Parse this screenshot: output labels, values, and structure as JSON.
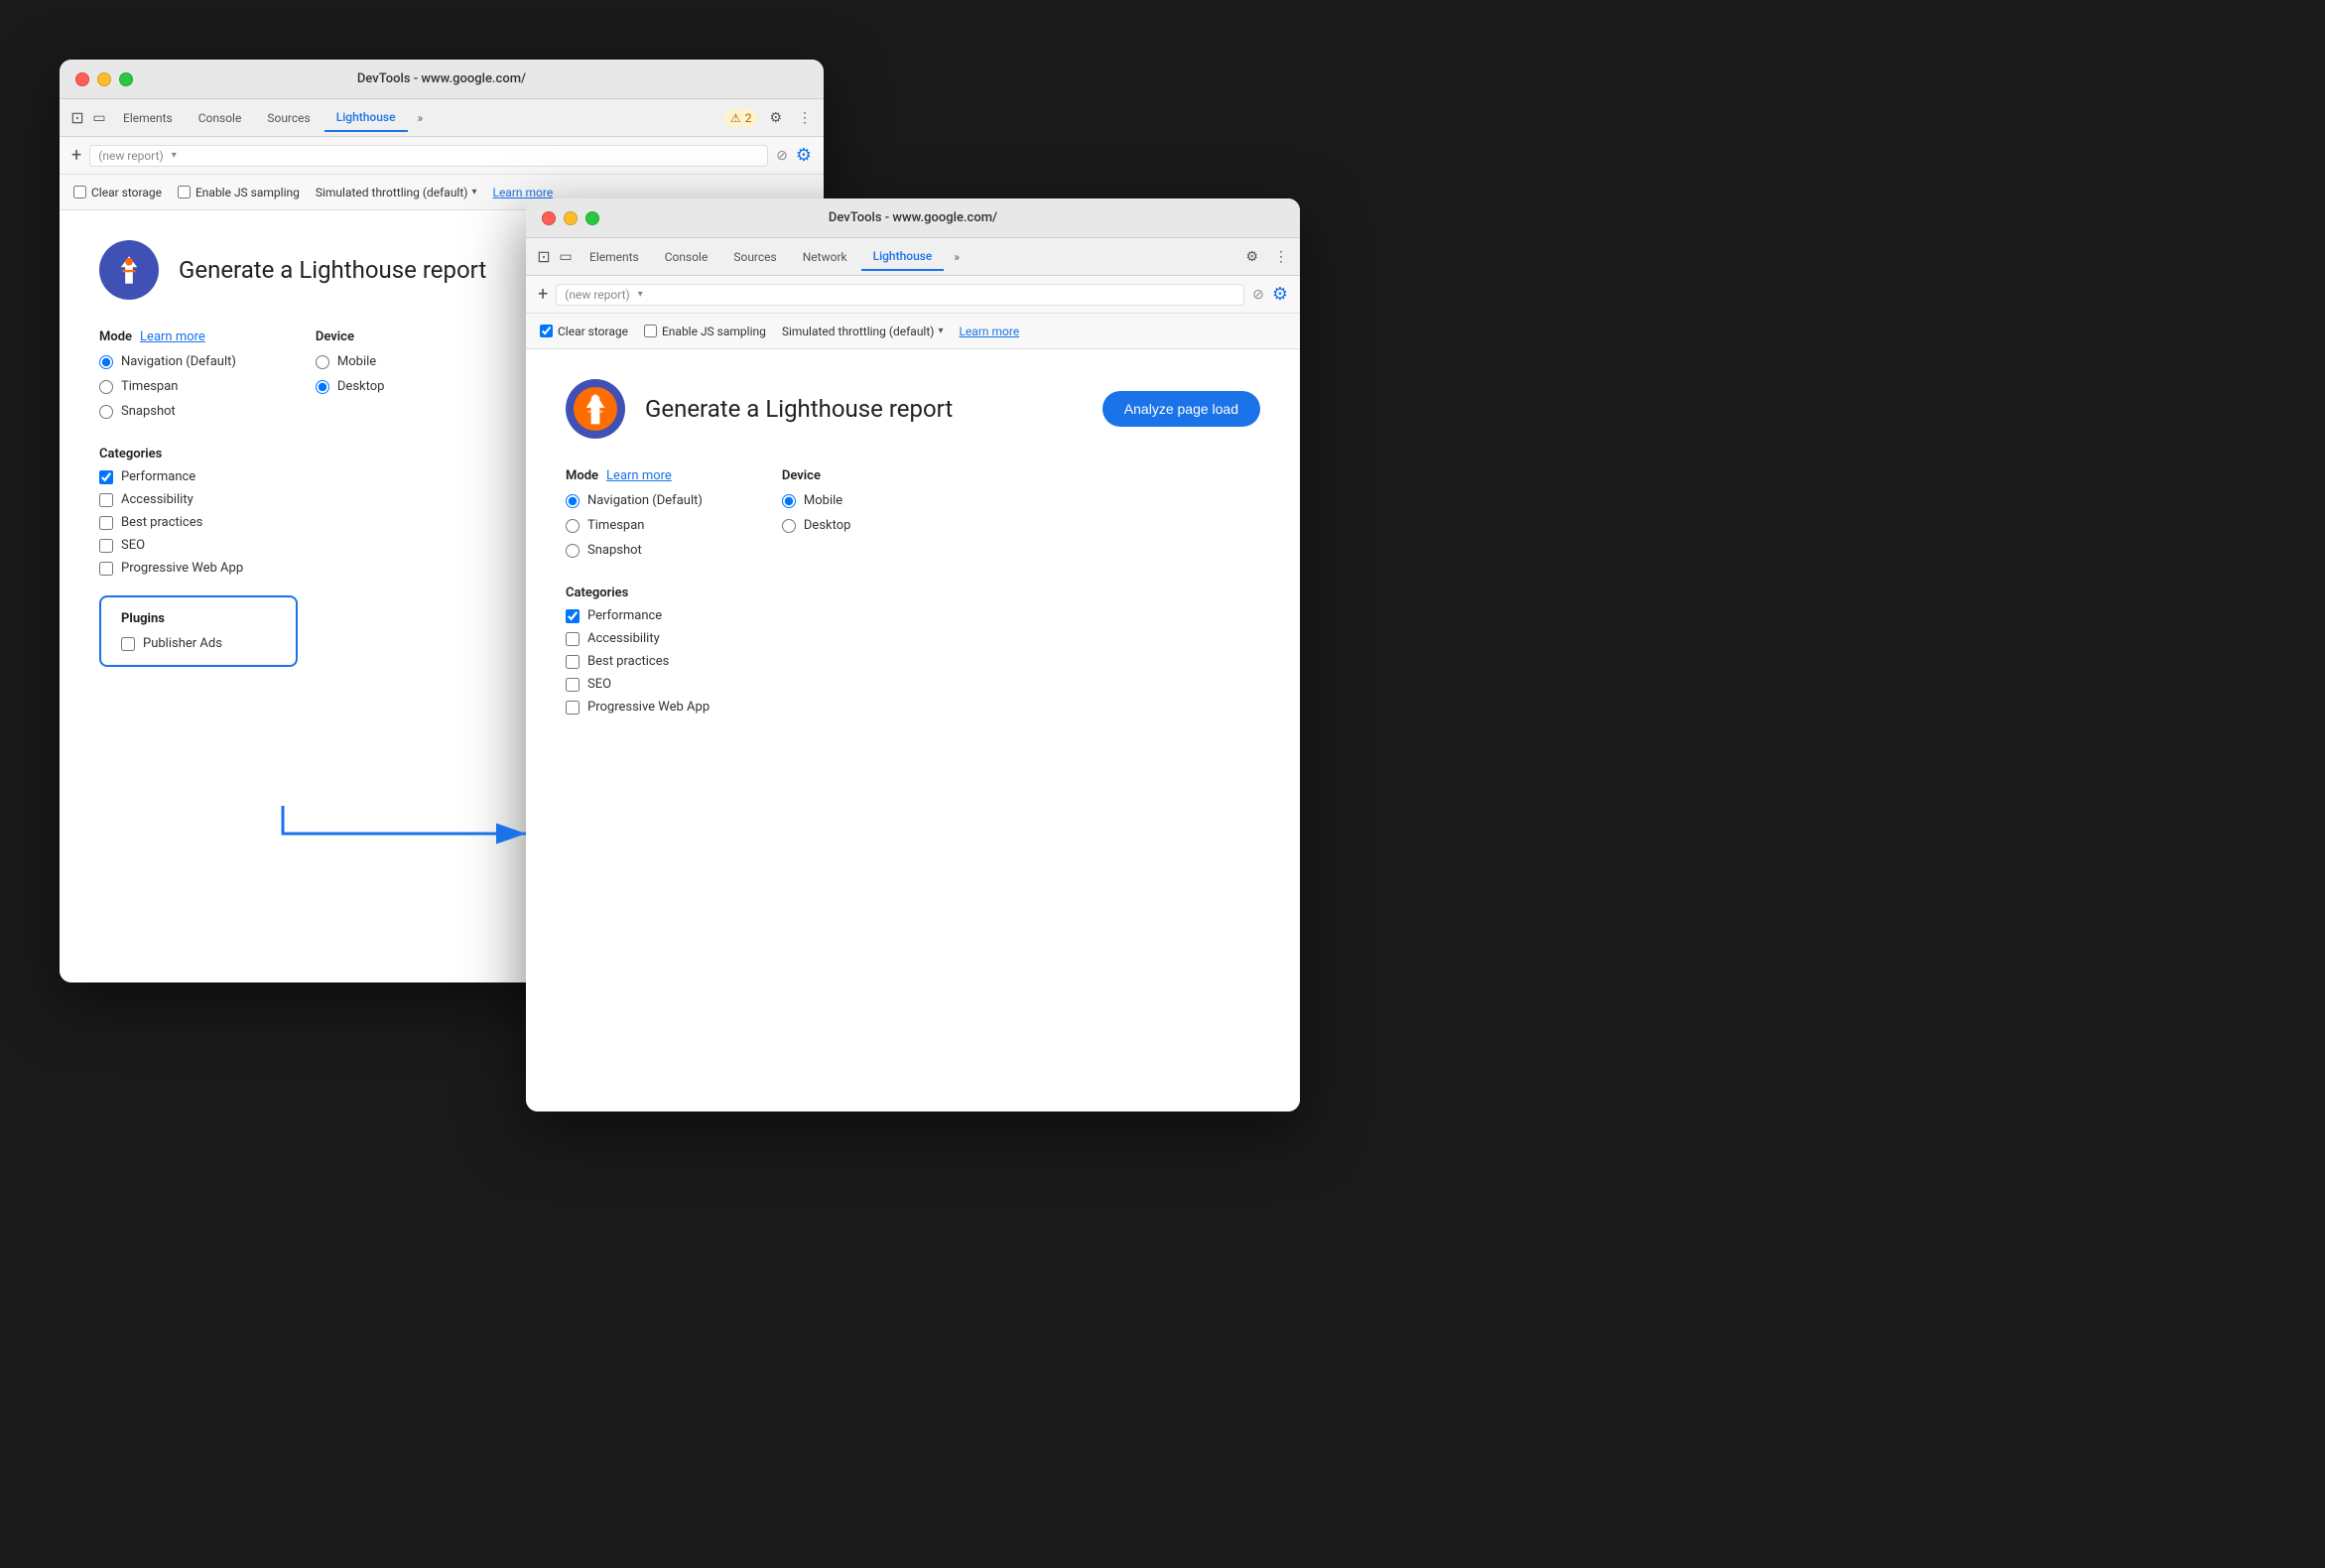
{
  "window1": {
    "title": "DevTools - www.google.com/",
    "tabs": [
      {
        "label": "Elements",
        "active": false
      },
      {
        "label": "Console",
        "active": false
      },
      {
        "label": "Sources",
        "active": false
      },
      {
        "label": "Lighthouse",
        "active": true
      },
      {
        "label": "»",
        "active": false
      }
    ],
    "warning_badge": "⚠ 2",
    "toolbar": {
      "new_report": "(new report)",
      "plus": "+",
      "cancel": "⊘"
    },
    "options": {
      "clear_storage": "Clear storage",
      "enable_js": "Enable JS sampling",
      "throttle": "Simulated throttling (default)",
      "learn_more": "Learn more"
    },
    "main": {
      "logo_alt": "Lighthouse Logo",
      "title": "Generate a Lighthouse report",
      "mode_label": "Mode",
      "learn_more": "Learn more",
      "mode_options": [
        "Navigation (Default)",
        "Timespan",
        "Snapshot"
      ],
      "mode_selected": "Navigation (Default)",
      "device_label": "Device",
      "device_options": [
        "Mobile",
        "Desktop"
      ],
      "device_selected": "Desktop",
      "categories_label": "Categories",
      "categories": [
        {
          "label": "Performance",
          "checked": true
        },
        {
          "label": "Accessibility",
          "checked": false
        },
        {
          "label": "Best practices",
          "checked": false
        },
        {
          "label": "SEO",
          "checked": false
        },
        {
          "label": "Progressive Web App",
          "checked": false
        }
      ],
      "plugins_label": "Plugins",
      "plugins": [
        {
          "label": "Publisher Ads",
          "checked": false
        }
      ]
    },
    "clear_storage_checked": false,
    "enable_js_checked": false
  },
  "window2": {
    "title": "DevTools - www.google.com/",
    "tabs": [
      {
        "label": "Elements",
        "active": false
      },
      {
        "label": "Console",
        "active": false
      },
      {
        "label": "Sources",
        "active": false
      },
      {
        "label": "Network",
        "active": false
      },
      {
        "label": "Lighthouse",
        "active": true
      },
      {
        "label": "»",
        "active": false
      }
    ],
    "toolbar": {
      "new_report": "(new report)",
      "plus": "+",
      "cancel": "⊘"
    },
    "options": {
      "clear_storage": "Clear storage",
      "enable_js": "Enable JS sampling",
      "throttle": "Simulated throttling (default)",
      "learn_more": "Learn more"
    },
    "main": {
      "logo_alt": "Lighthouse Logo",
      "title": "Generate a Lighthouse report",
      "analyze_btn": "Analyze page load",
      "mode_label": "Mode",
      "learn_more": "Learn more",
      "mode_options": [
        "Navigation (Default)",
        "Timespan",
        "Snapshot"
      ],
      "mode_selected": "Navigation (Default)",
      "device_label": "Device",
      "device_options": [
        "Mobile",
        "Desktop"
      ],
      "device_selected": "Mobile",
      "categories_label": "Categories",
      "categories": [
        {
          "label": "Performance",
          "checked": true
        },
        {
          "label": "Accessibility",
          "checked": false
        },
        {
          "label": "Best practices",
          "checked": false
        },
        {
          "label": "SEO",
          "checked": false
        },
        {
          "label": "Progressive Web App",
          "checked": false
        }
      ]
    },
    "clear_storage_checked": true,
    "enable_js_checked": false
  }
}
